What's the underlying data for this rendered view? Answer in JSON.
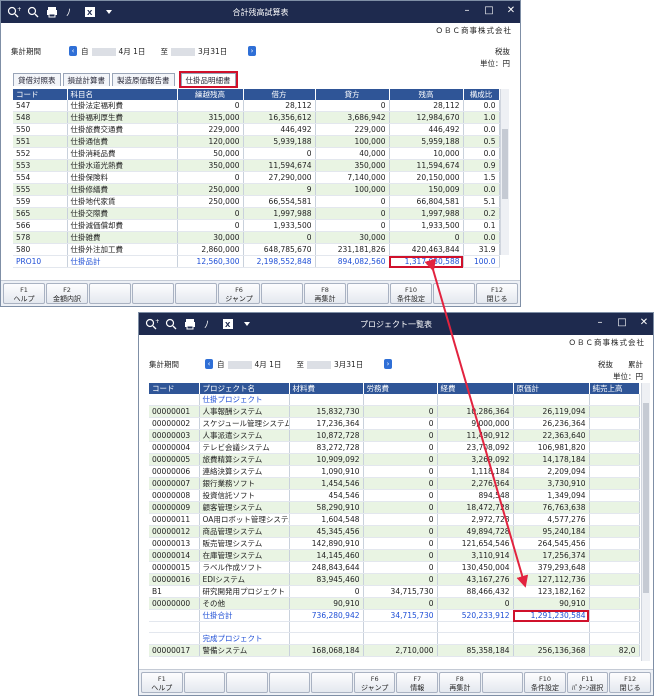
{
  "window1": {
    "title": "合計残高試算表",
    "company": "ＯＢＣ商事株式会社",
    "period_label": "集計期間",
    "from_prefix": "自",
    "from_date": "4月 1日",
    "to_prefix": "至",
    "to_date": "3月31日",
    "tax_label": "税抜",
    "unit_label": "単位：円",
    "tabs": [
      "貸借対照表",
      "損益計算書",
      "製造原価報告書",
      "仕掛品明細書"
    ],
    "columns": [
      "コード",
      "科目名",
      "繰越残高",
      "借方",
      "貸方",
      "残高",
      "構成比"
    ],
    "rows": [
      {
        "code": "547",
        "name": "仕掛法定福利費",
        "carry": "0",
        "debit": "28,112",
        "credit": "0",
        "balance": "28,112",
        "ratio": "0.0"
      },
      {
        "code": "548",
        "name": "仕掛福利厚生費",
        "carry": "315,000",
        "debit": "16,356,612",
        "credit": "3,686,942",
        "balance": "12,984,670",
        "ratio": "1.0"
      },
      {
        "code": "550",
        "name": "仕掛旅費交通費",
        "carry": "229,000",
        "debit": "446,492",
        "credit": "229,000",
        "balance": "446,492",
        "ratio": "0.0"
      },
      {
        "code": "551",
        "name": "仕掛通信費",
        "carry": "120,000",
        "debit": "5,939,188",
        "credit": "100,000",
        "balance": "5,959,188",
        "ratio": "0.5"
      },
      {
        "code": "552",
        "name": "仕掛消耗品費",
        "carry": "50,000",
        "debit": "0",
        "credit": "40,000",
        "balance": "10,000",
        "ratio": "0.0"
      },
      {
        "code": "553",
        "name": "仕掛水道光熱費",
        "carry": "350,000",
        "debit": "11,594,674",
        "credit": "350,000",
        "balance": "11,594,674",
        "ratio": "0.9"
      },
      {
        "code": "554",
        "name": "仕掛保険料",
        "carry": "0",
        "debit": "27,290,000",
        "credit": "7,140,000",
        "balance": "20,150,000",
        "ratio": "1.5"
      },
      {
        "code": "555",
        "name": "仕掛修繕費",
        "carry": "250,000",
        "debit": "9",
        "credit": "100,000",
        "balance": "150,009",
        "ratio": "0.0"
      },
      {
        "code": "559",
        "name": "仕掛地代家賃",
        "carry": "250,000",
        "debit": "66,554,581",
        "credit": "0",
        "balance": "66,804,581",
        "ratio": "5.1"
      },
      {
        "code": "565",
        "name": "仕掛交際費",
        "carry": "0",
        "debit": "1,997,988",
        "credit": "0",
        "balance": "1,997,988",
        "ratio": "0.2"
      },
      {
        "code": "566",
        "name": "仕掛減価償却費",
        "carry": "0",
        "debit": "1,933,500",
        "credit": "0",
        "balance": "1,933,500",
        "ratio": "0.1"
      },
      {
        "code": "578",
        "name": "仕掛雑費",
        "carry": "30,000",
        "debit": "0",
        "credit": "30,000",
        "balance": "0",
        "ratio": "0.0"
      },
      {
        "code": "580",
        "name": "仕掛外注加工費",
        "carry": "2,860,000",
        "debit": "648,785,670",
        "credit": "231,181,826",
        "balance": "420,463,844",
        "ratio": "31.9"
      }
    ],
    "total": {
      "code": "PRO10",
      "name": "仕掛品計",
      "carry": "12,560,300",
      "debit": "2,198,552,848",
      "credit": "894,082,560",
      "balance": "1,317,030,588",
      "ratio": "100.0"
    },
    "fkeys": [
      {
        "key": "F1",
        "label": "ヘルプ"
      },
      {
        "key": "F2",
        "label": "金額内訳"
      },
      {
        "key": "",
        "label": ""
      },
      {
        "key": "",
        "label": ""
      },
      {
        "key": "",
        "label": ""
      },
      {
        "key": "F6",
        "label": "ジャンプ"
      },
      {
        "key": "",
        "label": ""
      },
      {
        "key": "F8",
        "label": "再集計"
      },
      {
        "key": "",
        "label": ""
      },
      {
        "key": "F10",
        "label": "条件設定"
      },
      {
        "key": "",
        "label": ""
      },
      {
        "key": "F12",
        "label": "閉じる"
      }
    ]
  },
  "window2": {
    "title": "プロジェクト一覧表",
    "company": "ＯＢＣ商事株式会社",
    "period_label": "集計期間",
    "from_prefix": "自",
    "from_date": "4月 1日",
    "to_prefix": "至",
    "to_date": "3月31日",
    "tax_label": "税抜",
    "calc_label": "累計",
    "unit_label": "単位：円",
    "columns": [
      "コード",
      "プロジェクト名",
      "材料費",
      "労務費",
      "経費",
      "原価計",
      "純売上高"
    ],
    "section1": "仕掛プロジェクト",
    "rows": [
      {
        "code": "00000001",
        "name": "人事報酬システム",
        "mat": "15,832,730",
        "labor": "0",
        "exp": "10,286,364",
        "cost": "26,119,094"
      },
      {
        "code": "00000002",
        "name": "スケジュール管理システム",
        "mat": "17,236,364",
        "labor": "0",
        "exp": "9,000,000",
        "cost": "26,236,364"
      },
      {
        "code": "00000003",
        "name": "人事派遣システム",
        "mat": "10,872,728",
        "labor": "0",
        "exp": "11,490,912",
        "cost": "22,363,640"
      },
      {
        "code": "00000004",
        "name": "テレビ会議システム",
        "mat": "83,272,728",
        "labor": "0",
        "exp": "23,708,092",
        "cost": "106,981,820"
      },
      {
        "code": "00000005",
        "name": "旅費精算システム",
        "mat": "10,909,092",
        "labor": "0",
        "exp": "3,269,092",
        "cost": "14,178,184"
      },
      {
        "code": "00000006",
        "name": "連絡決算システム",
        "mat": "1,090,910",
        "labor": "0",
        "exp": "1,118,184",
        "cost": "2,209,094"
      },
      {
        "code": "00000007",
        "name": "銀行業務ソフト",
        "mat": "1,454,546",
        "labor": "0",
        "exp": "2,276,364",
        "cost": "3,730,910"
      },
      {
        "code": "00000008",
        "name": "投資信託ソフト",
        "mat": "454,546",
        "labor": "0",
        "exp": "894,548",
        "cost": "1,349,094"
      },
      {
        "code": "00000009",
        "name": "顧客管理システム",
        "mat": "58,290,910",
        "labor": "0",
        "exp": "18,472,728",
        "cost": "76,763,638"
      },
      {
        "code": "00000011",
        "name": "OA用ロボット管理システム",
        "mat": "1,604,548",
        "labor": "0",
        "exp": "2,972,728",
        "cost": "4,577,276"
      },
      {
        "code": "00000012",
        "name": "商品管理システム",
        "mat": "45,345,456",
        "labor": "0",
        "exp": "49,894,728",
        "cost": "95,240,184"
      },
      {
        "code": "00000013",
        "name": "販売管理システム",
        "mat": "142,890,910",
        "labor": "0",
        "exp": "121,654,546",
        "cost": "264,545,456"
      },
      {
        "code": "00000014",
        "name": "在庫管理システム",
        "mat": "14,145,460",
        "labor": "0",
        "exp": "3,110,914",
        "cost": "17,256,374"
      },
      {
        "code": "00000015",
        "name": "ラベル作成ソフト",
        "mat": "248,843,644",
        "labor": "0",
        "exp": "130,450,004",
        "cost": "379,293,648"
      },
      {
        "code": "00000016",
        "name": "EDIシステム",
        "mat": "83,945,460",
        "labor": "0",
        "exp": "43,167,276",
        "cost": "127,112,736"
      },
      {
        "code": "B1",
        "name": "研究開発用プロジェクト",
        "mat": "0",
        "labor": "34,715,730",
        "exp": "88,466,432",
        "cost": "123,182,162"
      },
      {
        "code": "00000000",
        "name": "その他",
        "mat": "90,910",
        "labor": "0",
        "exp": "0",
        "cost": "90,910"
      }
    ],
    "total": {
      "name": "仕掛合計",
      "mat": "736,280,942",
      "labor": "34,715,730",
      "exp": "520,233,912",
      "cost": "1,291,230,584"
    },
    "section2": "完成プロジェクト",
    "row_last": {
      "code": "00000017",
      "name": "警備システム",
      "mat": "168,068,184",
      "labor": "2,710,000",
      "exp": "85,358,184",
      "cost": "256,136,368",
      "sales": "82,0"
    },
    "fkeys": [
      {
        "key": "F1",
        "label": "ヘルプ"
      },
      {
        "key": "",
        "label": ""
      },
      {
        "key": "",
        "label": ""
      },
      {
        "key": "",
        "label": ""
      },
      {
        "key": "",
        "label": ""
      },
      {
        "key": "F6",
        "label": "ジャンプ"
      },
      {
        "key": "F7",
        "label": "情報"
      },
      {
        "key": "F8",
        "label": "再集計"
      },
      {
        "key": "",
        "label": ""
      },
      {
        "key": "F10",
        "label": "条件設定"
      },
      {
        "key": "F11",
        "label": "ﾊﾟﾀｰﾝ選択"
      },
      {
        "key": "F12",
        "label": "閉じる"
      }
    ]
  },
  "colors": {
    "titlebar": "#1e2a4e",
    "header": "#2f5597",
    "highlight": "#d0112b",
    "total_text": "#1f4fd6",
    "row_green": "#e9f4e3"
  }
}
